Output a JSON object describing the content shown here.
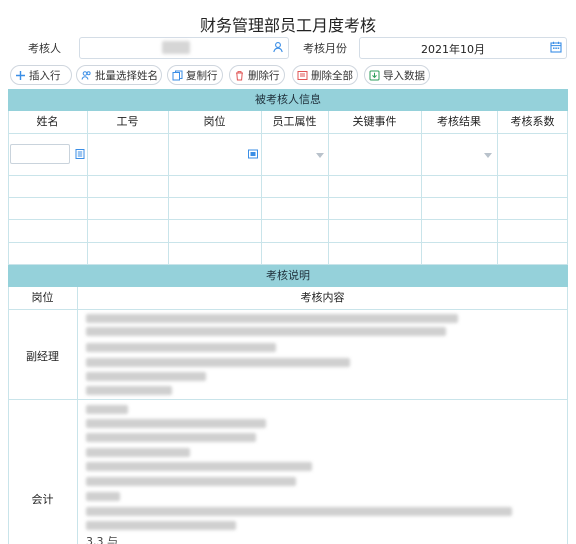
{
  "page": {
    "title": "财务管理部员工月度考核"
  },
  "header": {
    "assessor_label": "考核人",
    "month_label": "考核月份",
    "month_value": "2021年10月",
    "user_icon": "user-icon",
    "calendar_icon": "calendar-icon"
  },
  "toolbar": {
    "buttons": [
      {
        "label": "插入行",
        "icon": "plus-icon"
      },
      {
        "label": "批量选择姓名",
        "icon": "users-icon"
      },
      {
        "label": "复制行",
        "icon": "copy-icon"
      },
      {
        "label": "删除行",
        "icon": "trash-icon"
      },
      {
        "label": "删除全部",
        "icon": "clear-all-icon"
      },
      {
        "label": "导入数据",
        "icon": "import-icon"
      }
    ]
  },
  "assessee_section": {
    "title": "被考核人信息",
    "columns": [
      "姓名",
      "工号",
      "岗位",
      "员工属性",
      "关键事件",
      "考核结果",
      "考核系数"
    ]
  },
  "explanation_section": {
    "title": "考核说明",
    "col_position": "岗位",
    "col_content": "考核内容",
    "roles": [
      {
        "name": "副经理"
      },
      {
        "name": "会计",
        "visible_tail": "3.3 与"
      }
    ]
  },
  "colors": {
    "section_header": "#95d1da",
    "grid_line": "#c9e4ea",
    "accent": "#3a8ee6"
  }
}
